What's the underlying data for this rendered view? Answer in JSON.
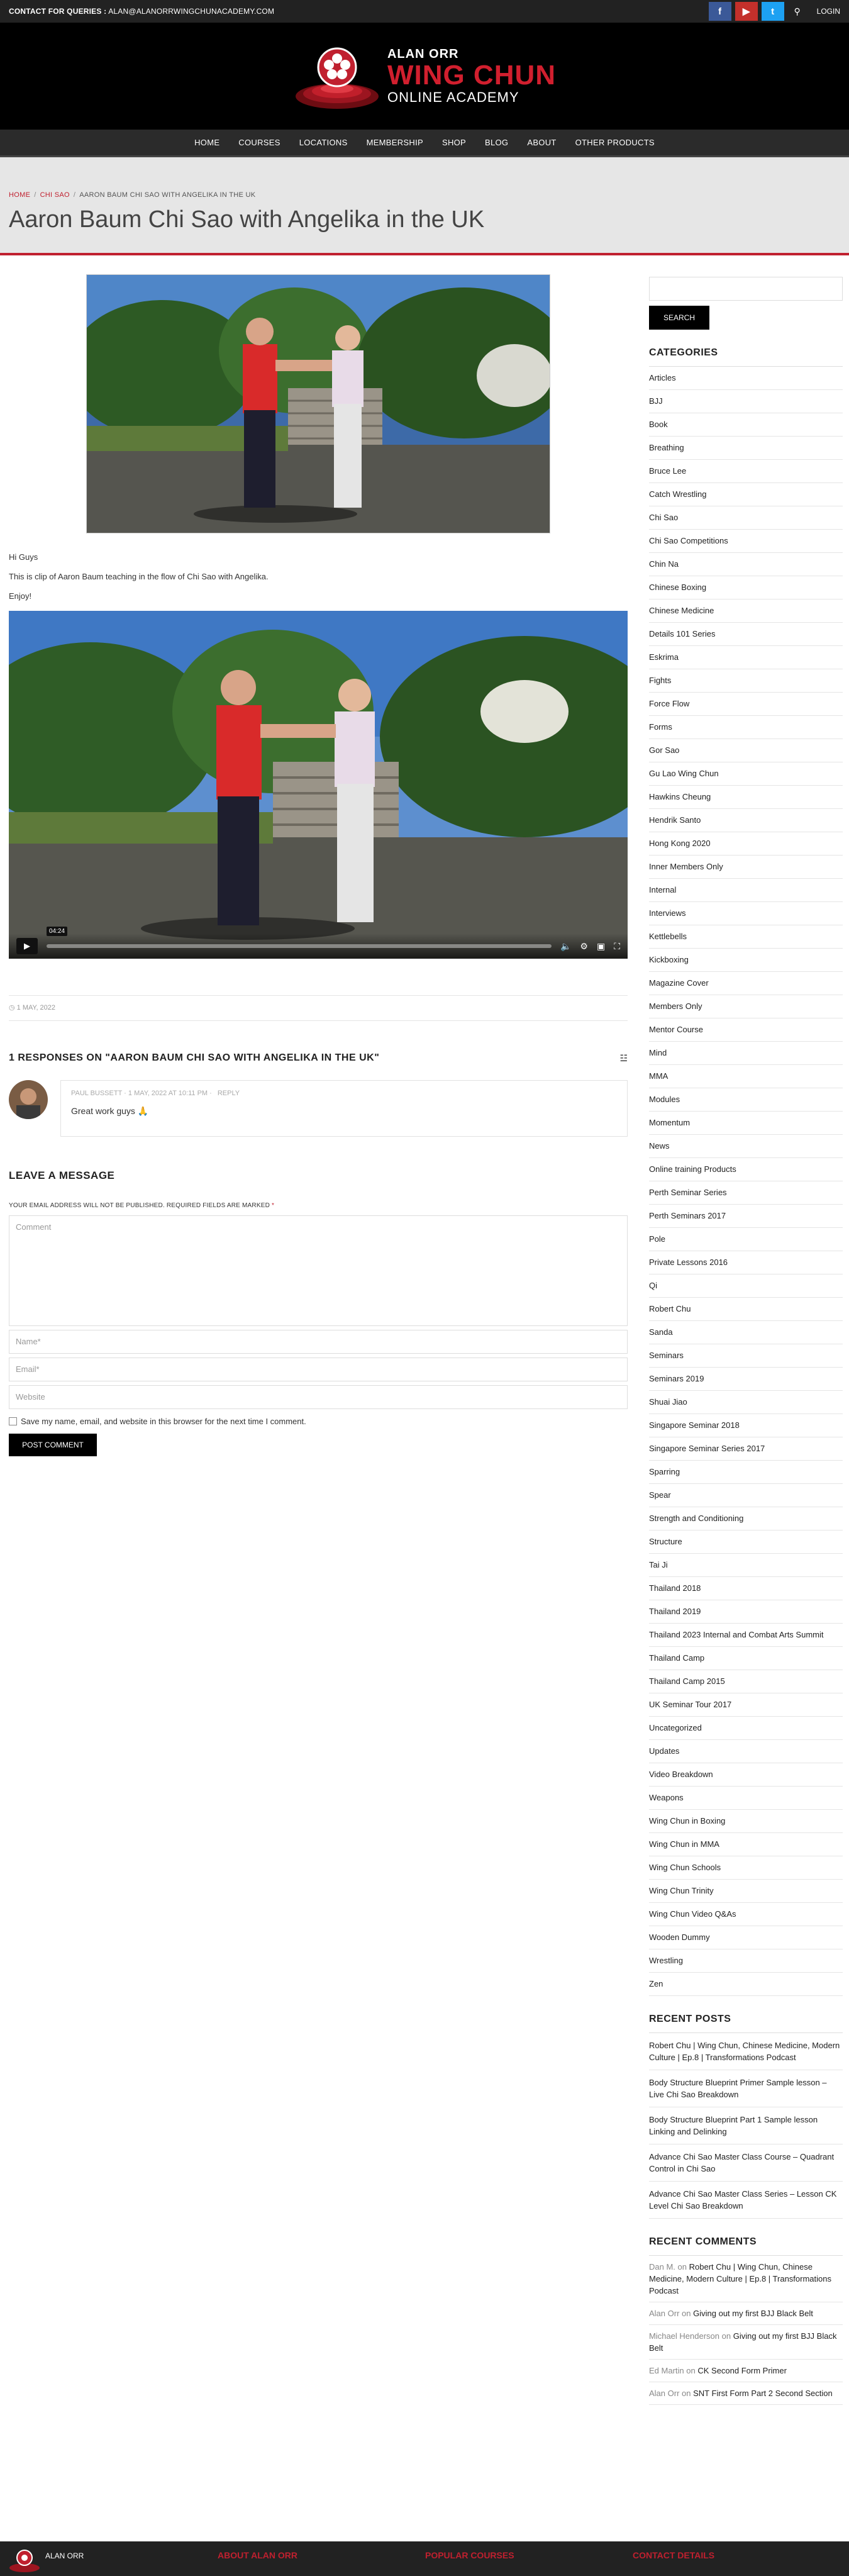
{
  "topbar": {
    "contact_label": "CONTACT FOR QUERIES :",
    "contact_email": "ALAN@ALANORRWINGCHUNACADEMY.COM",
    "login": "LOGIN"
  },
  "logo": {
    "line1": "ALAN ORR",
    "line2": "WING CHUN",
    "line3": "ONLINE ACADEMY"
  },
  "nav": [
    "HOME",
    "COURSES",
    "LOCATIONS",
    "MEMBERSHIP",
    "SHOP",
    "BLOG",
    "ABOUT",
    "OTHER PRODUCTS"
  ],
  "breadcrumb": {
    "home": "HOME",
    "cat": "CHI SAO",
    "current": "AARON BAUM CHI SAO WITH ANGELIKA IN THE UK"
  },
  "page_title": "Aaron Baum Chi Sao with Angelika in the UK",
  "content": {
    "p1": "Hi Guys",
    "p2": "This is clip of Aaron Baum teaching in the flow of Chi Sao with Angelika.",
    "p3": "Enjoy!"
  },
  "video": {
    "time": "04:24"
  },
  "post_date": "1 MAY, 2022",
  "responses_heading": "1 RESPONSES ON \"AARON BAUM CHI SAO WITH ANGELIKA IN THE UK\"",
  "comment": {
    "author": "PAUL BUSSETT",
    "date": "1 MAY, 2022 AT 10:11 PM",
    "reply": "REPLY",
    "text": "Great work guys 🙏"
  },
  "leave": {
    "heading": "LEAVE A MESSAGE",
    "notes": "YOUR EMAIL ADDRESS WILL NOT BE PUBLISHED. REQUIRED FIELDS ARE MARKED",
    "req_mark": "*",
    "comment_ph": "Comment",
    "name_ph": "Name*",
    "email_ph": "Email*",
    "website_ph": "Website",
    "save_label": "Save my name, email, and website in this browser for the next time I comment.",
    "submit": "POST COMMENT"
  },
  "sidebar": {
    "search_btn": "SEARCH",
    "categories_title": "CATEGORIES",
    "categories": [
      "Articles",
      "BJJ",
      "Book",
      "Breathing",
      "Bruce Lee",
      "Catch Wrestling",
      "Chi Sao",
      "Chi Sao Competitions",
      "Chin Na",
      "Chinese Boxing",
      "Chinese Medicine",
      "Details 101 Series",
      "Eskrima",
      "Fights",
      "Force Flow",
      "Forms",
      "Gor Sao",
      "Gu Lao Wing Chun",
      "Hawkins Cheung",
      "Hendrik Santo",
      "Hong Kong 2020",
      "Inner Members Only",
      "Internal",
      "Interviews",
      "Kettlebells",
      "Kickboxing",
      "Magazine Cover",
      "Members Only",
      "Mentor Course",
      "Mind",
      "MMA",
      "Modules",
      "Momentum",
      "News",
      "Online training Products",
      "Perth Seminar Series",
      "Perth Seminars 2017",
      "Pole",
      "Private Lessons 2016",
      "Qi",
      "Robert Chu",
      "Sanda",
      "Seminars",
      "Seminars 2019",
      "Shuai Jiao",
      "Singapore Seminar 2018",
      "Singapore Seminar Series 2017",
      "Sparring",
      "Spear",
      "Strength and Conditioning",
      "Structure",
      "Tai Ji",
      "Thailand 2018",
      "Thailand 2019",
      "Thailand 2023 Internal and Combat Arts Summit",
      "Thailand Camp",
      "Thailand Camp 2015",
      "UK Seminar Tour 2017",
      "Uncategorized",
      "Updates",
      "Video Breakdown",
      "Weapons",
      "Wing Chun in Boxing",
      "Wing Chun in MMA",
      "Wing Chun Schools",
      "Wing Chun Trinity",
      "Wing Chun Video Q&As",
      "Wooden Dummy",
      "Wrestling",
      "Zen"
    ],
    "recent_posts_title": "RECENT POSTS",
    "recent_posts": [
      "Robert Chu | Wing Chun, Chinese Medicine, Modern Culture | Ep.8 | Transformations Podcast",
      "Body Structure Blueprint Primer Sample lesson – Live Chi Sao Breakdown",
      "Body Structure Blueprint Part 1 Sample lesson Linking and Delinking",
      "Advance Chi Sao Master Class Course – Quadrant Control in Chi Sao",
      "Advance Chi Sao Master Class Series – Lesson CK Level Chi Sao Breakdown"
    ],
    "recent_comments_title": "RECENT COMMENTS",
    "recent_comments": [
      {
        "author": "Dan M.",
        "on": "on",
        "post": "Robert Chu | Wing Chun, Chinese Medicine, Modern Culture | Ep.8 | Transformations Podcast"
      },
      {
        "author": "Alan Orr",
        "on": "on",
        "post": "Giving out my first BJJ Black Belt"
      },
      {
        "author": "Michael Henderson",
        "on": "on",
        "post": "Giving out my first BJJ Black Belt"
      },
      {
        "author": "Ed Martin",
        "on": "on",
        "post": "CK Second Form Primer"
      },
      {
        "author": "Alan Orr",
        "on": "on",
        "post": "SNT First Form Part 2 Second Section"
      }
    ]
  },
  "footer": {
    "logo_text": "ALAN ORR",
    "col1": "ABOUT ALAN ORR",
    "col2": "POPULAR COURSES",
    "col3": "CONTACT DETAILS"
  },
  "colors": {
    "accent": "#c0202f",
    "dark": "#222222"
  }
}
